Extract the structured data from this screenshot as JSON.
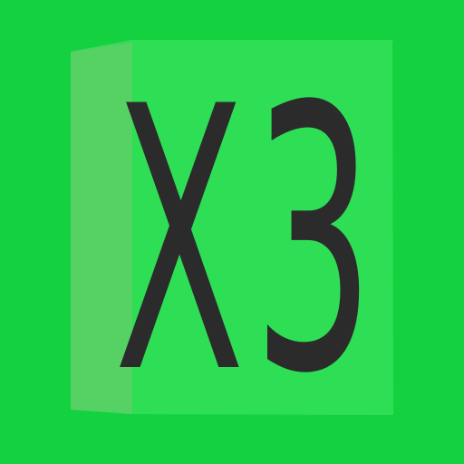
{
  "icon": {
    "name": "x3-block-icon",
    "glyph_left": "X",
    "glyph_right": "3"
  },
  "colors": {
    "background": "#14d23f",
    "block_front": "#2ede55",
    "block_side": "#56d264",
    "block_top": "#3ad85a",
    "glyph": "#2b2b2b"
  }
}
